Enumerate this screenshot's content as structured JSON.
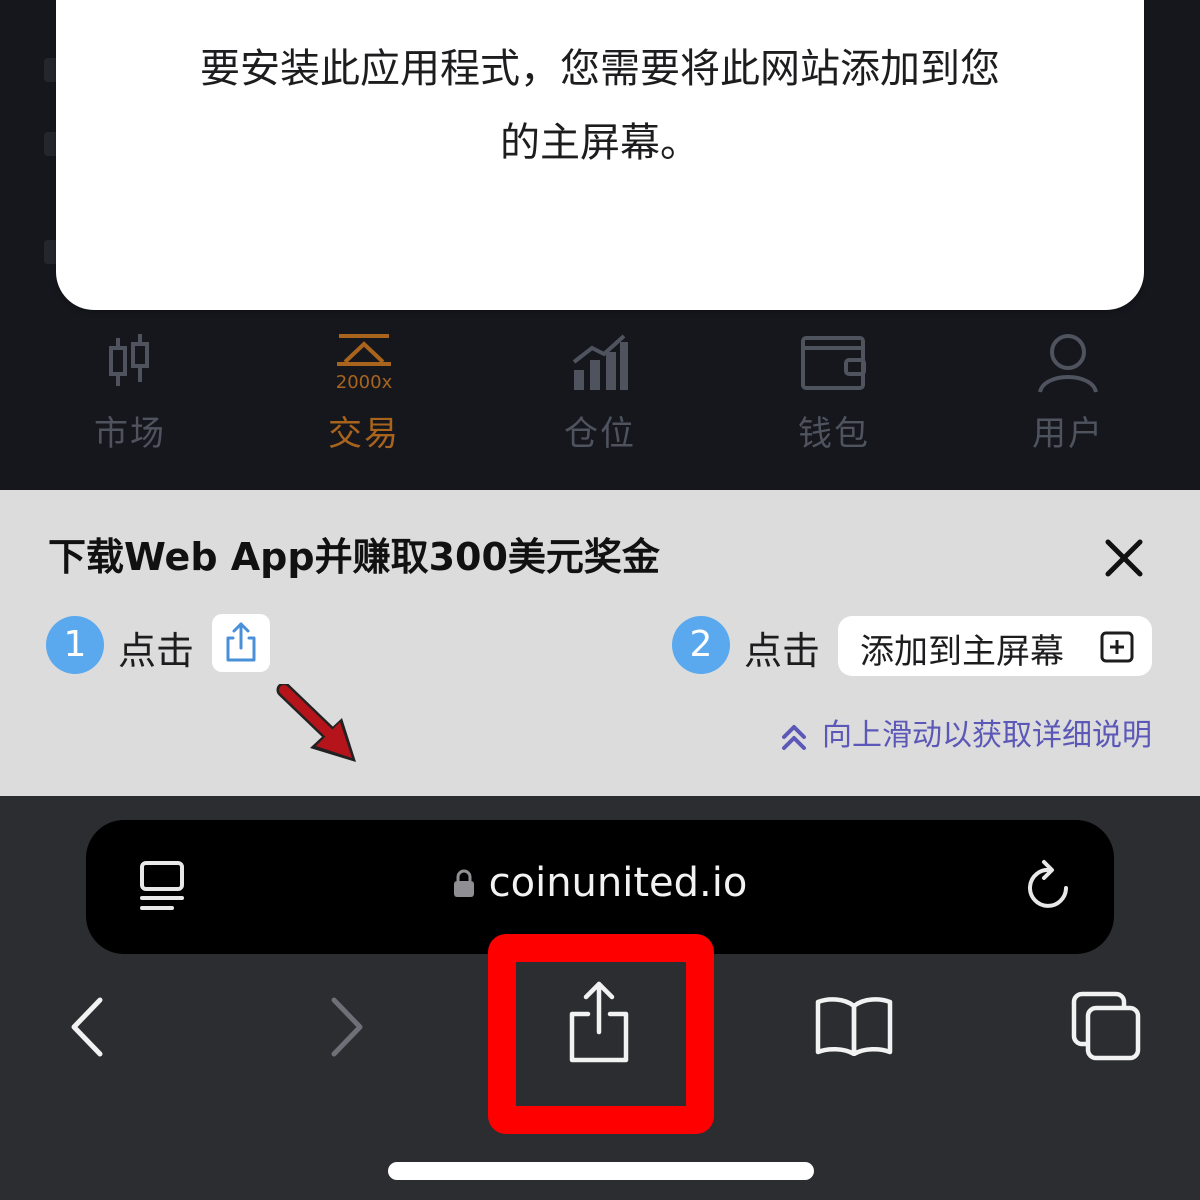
{
  "modal": {
    "text_line1": "要安装此应用程式，您需要将此网站添加到您",
    "text_line2": "的主屏幕。"
  },
  "tabbar": {
    "items": [
      {
        "label": "市场",
        "icon": "candlestick-icon",
        "active": false
      },
      {
        "label": "交易",
        "icon": "trade-scale-icon",
        "badge": "2000x",
        "active": true
      },
      {
        "label": "仓位",
        "icon": "bar-chart-up-icon",
        "active": false
      },
      {
        "label": "钱包",
        "icon": "wallet-icon",
        "active": false
      },
      {
        "label": "用户",
        "icon": "user-icon",
        "active": false
      }
    ]
  },
  "banner": {
    "title": "下载Web App并赚取300美元奖金",
    "close_icon": "close-icon",
    "step1": {
      "number": "1",
      "text": "点击",
      "icon": "share-icon"
    },
    "step2": {
      "number": "2",
      "text": "点击",
      "pill_label": "添加到主屏幕",
      "pill_icon": "plus-square-icon"
    },
    "swipe_hint": "向上滑动以获取详细说明"
  },
  "safari": {
    "url": "coinunited.io",
    "left_icon": "reader-icon",
    "right_icon": "reload-icon",
    "toolbar": [
      "back-icon",
      "forward-icon",
      "share-icon",
      "bookmarks-icon",
      "tabs-icon"
    ]
  },
  "colors": {
    "accent_orange": "#a8641c",
    "step_blue": "#5aa8ee",
    "hint_purple": "#5b58b8",
    "highlight_red": "#ff0000"
  }
}
